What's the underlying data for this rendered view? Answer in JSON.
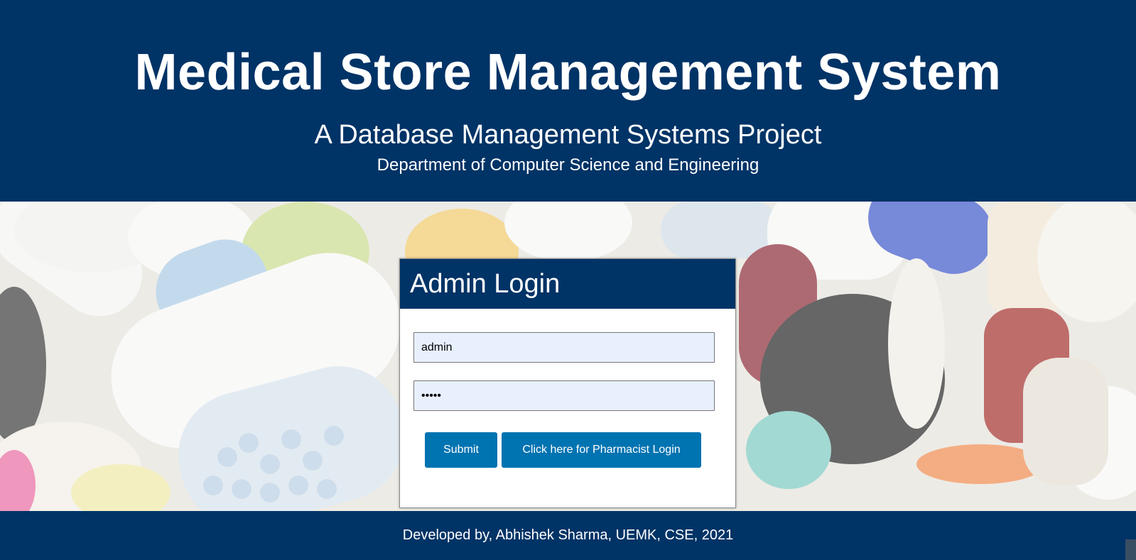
{
  "header": {
    "title": "Medical Store Management System",
    "subtitle": "A Database Management Systems Project",
    "department": "Department of Computer Science and Engineering"
  },
  "hero": {
    "image_icon": "pills-background-image"
  },
  "login": {
    "heading": "Admin Login",
    "username_value": "admin",
    "password_value": "admin",
    "submit_label": "Submit",
    "pharmacist_label": "Click here for Pharmacist Login"
  },
  "footer": {
    "text": "Developed by, Abhishek Sharma, UEMK, CSE, 2021"
  },
  "colors": {
    "primary": "#003366",
    "button": "#0073b1",
    "input_bg": "#e8f0fe"
  }
}
